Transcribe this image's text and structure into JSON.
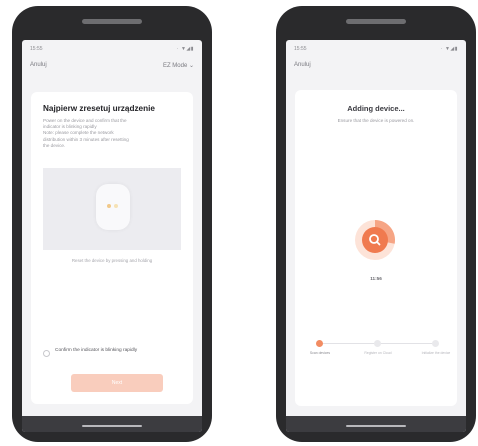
{
  "left_phone": {
    "status_time": "15:55",
    "status_icons": "· ▼◢▮",
    "back_label": "Anuluj",
    "mode_label": "EZ Mode ⌄",
    "title": "Najpierw zresetuj urządzenie",
    "instructions": [
      "Power on the device and confirm that the",
      "indicator is blinking rapidly",
      "Note: please complete the network",
      "distribution within 3 minutes after resetting",
      "the device."
    ],
    "hint": "Reset the device by pressing and holding",
    "confirm_text": "Confirm the indicator is blinking rapidly",
    "next_label": "Next"
  },
  "right_phone": {
    "status_time": "15:55",
    "status_icons": "· ▼◢▮",
    "back_label": "Anuluj",
    "title": "Adding device...",
    "subtitle": "Ensure that the device is powered on.",
    "progress_text": "11:56",
    "progress_fraction": 0.28,
    "steps": [
      {
        "label": "Scan devices",
        "active": true
      },
      {
        "label": "Register on Cloud",
        "active": false
      },
      {
        "label": "Initialize the device",
        "active": false
      }
    ]
  },
  "colors": {
    "accent": "#f07a4f",
    "accent_light": "#f9cdbd",
    "phone_body": "#2a2a2c",
    "screen_bg": "#f3f3f5"
  },
  "icons": {
    "search": "search-icon"
  }
}
